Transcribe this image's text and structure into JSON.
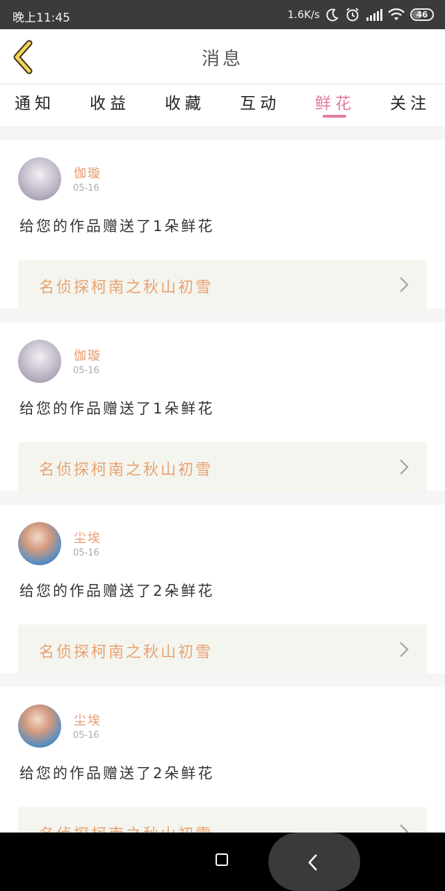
{
  "status_bar": {
    "time": "晚上11:45",
    "net_speed": "1.6K/s",
    "battery": "46"
  },
  "header": {
    "title": "消息"
  },
  "tabs": [
    {
      "label": "通知",
      "active": false
    },
    {
      "label": "收益",
      "active": false
    },
    {
      "label": "收藏",
      "active": false
    },
    {
      "label": "互动",
      "active": false
    },
    {
      "label": "鲜花",
      "active": true
    },
    {
      "label": "关注",
      "active": false
    }
  ],
  "colors": {
    "accent": "#e07aa0",
    "username": "#e69a6e",
    "work_title": "#e8a171"
  },
  "messages": [
    {
      "user": "伽璇",
      "date": "05-16",
      "text": "给您的作品赠送了1朵鲜花",
      "work": "名侦探柯南之秋山初雪"
    },
    {
      "user": "伽璇",
      "date": "05-16",
      "text": "给您的作品赠送了1朵鲜花",
      "work": "名侦探柯南之秋山初雪"
    },
    {
      "user": "尘埃",
      "date": "05-16",
      "text": "给您的作品赠送了2朵鲜花",
      "work": "名侦探柯南之秋山初雪"
    },
    {
      "user": "尘埃",
      "date": "05-16",
      "text": "给您的作品赠送了2朵鲜花",
      "work": "名侦探柯南之秋山初雪"
    }
  ]
}
